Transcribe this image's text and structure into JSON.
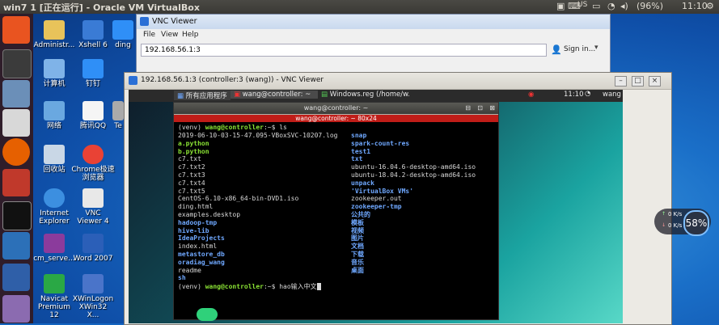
{
  "topbar": {
    "title": "win7 1 [正在运行] - Oracle VM VirtualBox",
    "keyboard": "US",
    "battery": "(96%)",
    "time": "11:10"
  },
  "desktop_icons": [
    {
      "label": "Administr...",
      "icon": "user-folder-icon",
      "color": "#e8c35a"
    },
    {
      "label": "Xshell 6",
      "icon": "xshell-icon",
      "color": "#3a7bd5"
    },
    {
      "label": "ding",
      "icon": "dingtalk-icon",
      "color": "#2f8ff7"
    },
    {
      "label": "计算机",
      "icon": "computer-icon",
      "color": "#7fb3e8"
    },
    {
      "label": "钉钉",
      "icon": "dingtalk-icon",
      "color": "#2f8ff7"
    },
    {
      "label": "网络",
      "icon": "network-icon",
      "color": "#6aa8e0"
    },
    {
      "label": "腾讯QQ",
      "icon": "qq-icon",
      "color": "#f5f5f5"
    },
    {
      "label": "Te",
      "icon": "app-icon",
      "color": "#aaaaaa"
    },
    {
      "label": "回收站",
      "icon": "recycle-bin-icon",
      "color": "#c9d7e6"
    },
    {
      "label": "Chrome极速浏览器",
      "icon": "chrome-icon",
      "color": "#e94235"
    },
    {
      "label": "Internet Explorer",
      "icon": "ie-icon",
      "color": "#3c8fe0"
    },
    {
      "label": "VNC Viewer 4",
      "icon": "vnc-icon",
      "color": "#e8e8e8"
    },
    {
      "label": "cm_serve...",
      "icon": "winrar-icon",
      "color": "#8b3b9c"
    },
    {
      "label": "Word 2007",
      "icon": "word-icon",
      "color": "#2b5fb8"
    },
    {
      "label": "Navicat Premium 12",
      "icon": "navicat-icon",
      "color": "#2aa845"
    },
    {
      "label": "XWinLogon XWin32 X...",
      "icon": "xwin-icon",
      "color": "#4a74c9"
    }
  ],
  "vnc_viewer": {
    "title": "VNC Viewer",
    "menu": [
      "File",
      "View",
      "Help"
    ],
    "address": "192.168.56.1:3",
    "sign_in": "Sign in..."
  },
  "vnc_session": {
    "title": "192.168.56.1:3 (controller:3 (wang)) - VNC Viewer",
    "panel_items": [
      "所有应用程序",
      "wang@controller: ~",
      "Windows.reg (/home/w..."
    ],
    "panel_time": "11:10",
    "panel_user": "wang"
  },
  "terminal": {
    "title": "wang@controller: ~",
    "tab": "wang@controller: ~ 80x24",
    "prompt_env": "(venv) ",
    "prompt_user": "wang@controller",
    "prompt_sep": ":~$ ",
    "command1": "ls",
    "col1": [
      {
        "t": "2019-06-10-03-15-47.095-VBoxSVC-10207.log",
        "c": "w"
      },
      {
        "t": "a.python",
        "c": "g"
      },
      {
        "t": "b.python",
        "c": "g"
      },
      {
        "t": "c7.txt",
        "c": "w"
      },
      {
        "t": "c7.txt2",
        "c": "w"
      },
      {
        "t": "c7.txt3",
        "c": "w"
      },
      {
        "t": "c7.txt4",
        "c": "w"
      },
      {
        "t": "c7.txt5",
        "c": "w"
      },
      {
        "t": "CentOS-6.10-x86_64-bin-DVD1.iso",
        "c": "w"
      },
      {
        "t": "ding.html",
        "c": "w"
      },
      {
        "t": "examples.desktop",
        "c": "w"
      },
      {
        "t": "hadoop-tmp",
        "c": "b"
      },
      {
        "t": "hive-lib",
        "c": "b"
      },
      {
        "t": "IdeaProjects",
        "c": "b"
      },
      {
        "t": "index.html",
        "c": "w"
      },
      {
        "t": "metastore_db",
        "c": "b"
      },
      {
        "t": "oradiag_wang",
        "c": "b"
      },
      {
        "t": "readme",
        "c": "w"
      },
      {
        "t": "sh",
        "c": "b"
      }
    ],
    "col2": [
      {
        "t": "snap",
        "c": "b"
      },
      {
        "t": "spark-count-res",
        "c": "b"
      },
      {
        "t": "test1",
        "c": "b"
      },
      {
        "t": "txt",
        "c": "b"
      },
      {
        "t": "ubuntu-16.04.6-desktop-amd64.iso",
        "c": "w"
      },
      {
        "t": "ubuntu-18.04.2-desktop-amd64.iso",
        "c": "w"
      },
      {
        "t": "unpack",
        "c": "b"
      },
      {
        "t": "'VirtualBox VMs'",
        "c": "b"
      },
      {
        "t": "zookeeper.out",
        "c": "w"
      },
      {
        "t": "zookeeper-tmp",
        "c": "b"
      },
      {
        "t": "公共的",
        "c": "b"
      },
      {
        "t": "模板",
        "c": "b"
      },
      {
        "t": "视频",
        "c": "b"
      },
      {
        "t": "图片",
        "c": "b"
      },
      {
        "t": "文档",
        "c": "b"
      },
      {
        "t": "下载",
        "c": "b"
      },
      {
        "t": "音乐",
        "c": "b"
      },
      {
        "t": "桌面",
        "c": "b"
      }
    ],
    "command2": "hao输入中文"
  },
  "net_widget": {
    "up": "0 K/s",
    "down": "0 K/s",
    "percent": "58%"
  }
}
